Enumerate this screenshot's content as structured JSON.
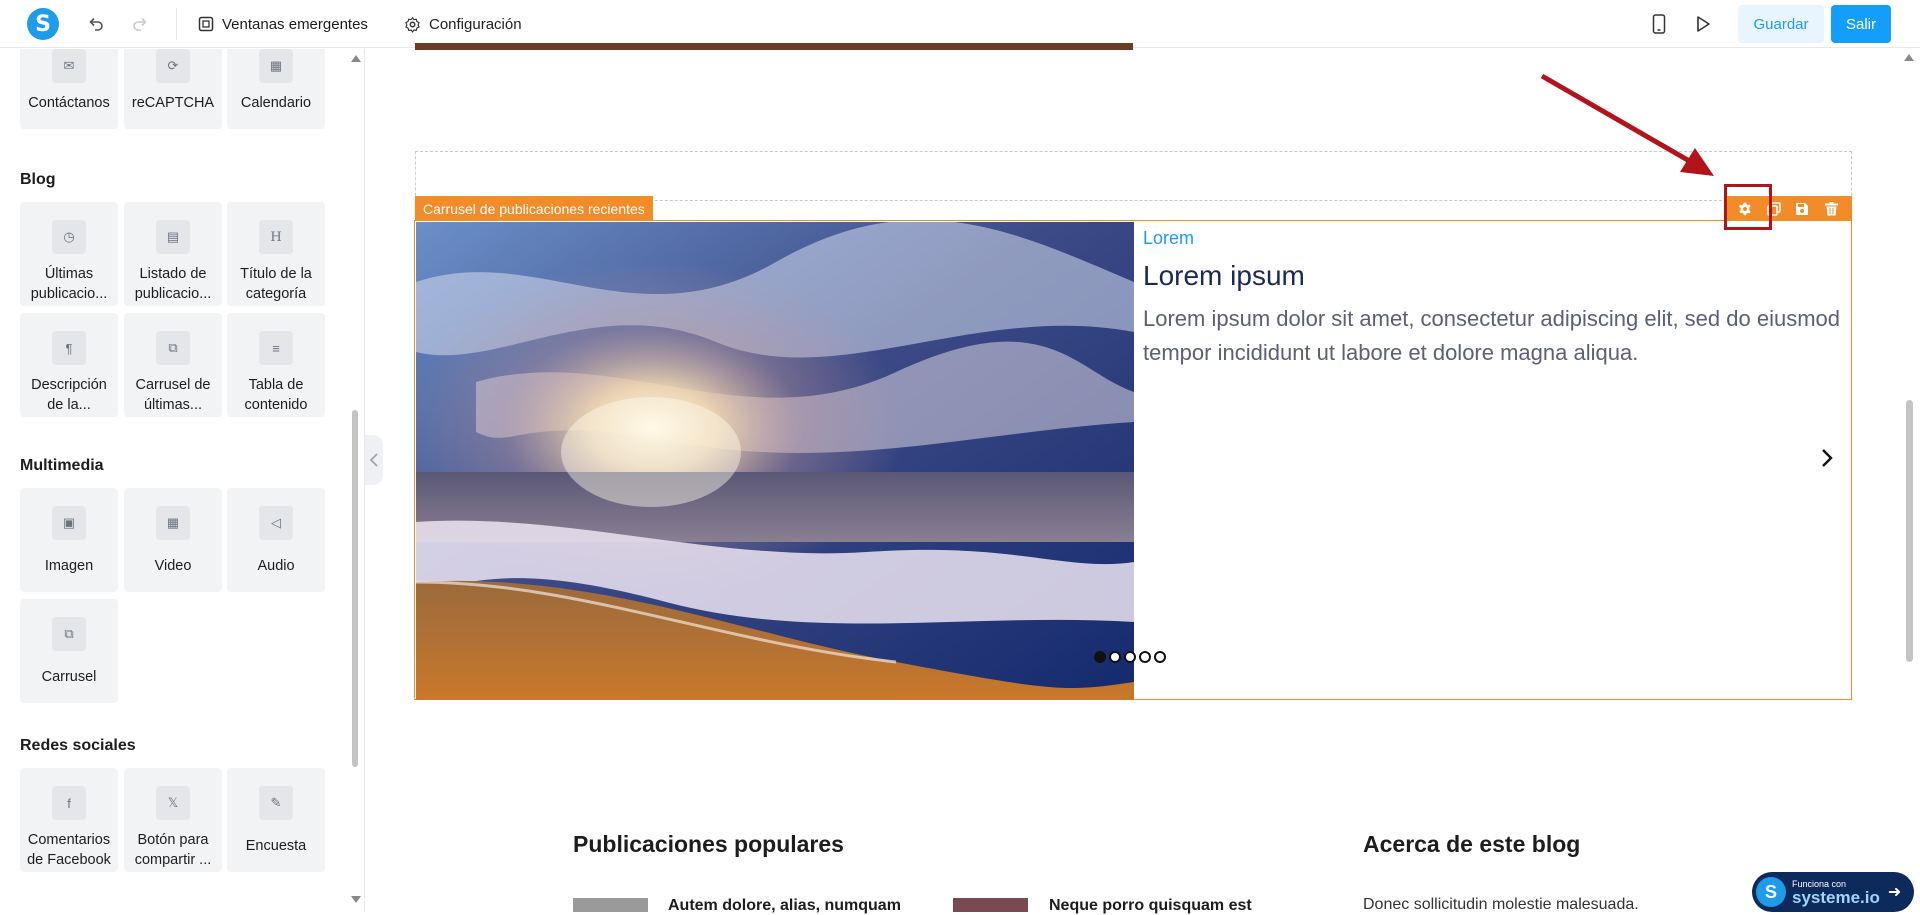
{
  "topbar": {
    "popups_label": "Ventanas emergentes",
    "settings_label": "Configuración",
    "save_label": "Guardar",
    "exit_label": "Salir"
  },
  "sidebar": {
    "top_tiles": [
      "Contáctanos",
      "reCAPTCHA",
      "Calendario"
    ],
    "sections": [
      {
        "title": "Blog",
        "tiles": [
          "Últimas publicacio...",
          "Listado de publicacio...",
          "Título de la categoría",
          "Descripción de la...",
          "Carrusel de últimas...",
          "Tabla de contenido"
        ]
      },
      {
        "title": "Multimedia",
        "tiles": [
          "Imagen",
          "Video",
          "Audio",
          "Carrusel"
        ]
      },
      {
        "title": "Redes sociales",
        "tiles": [
          "Comentarios de Facebook",
          "Botón para compartir ...",
          "Encuesta"
        ]
      }
    ]
  },
  "canvas": {
    "block_label": "Carrusel de publicaciones recientes",
    "post": {
      "category": "Lorem",
      "title": "Lorem ipsum",
      "description": "Lorem ipsum dolor sit amet, consectetur adipiscing elit, sed do eiusmod tempor incididunt ut labore et dolore magna aliqua."
    },
    "carousel_dots": 5,
    "active_dot": 0,
    "popular_heading": "Publicaciones populares",
    "about_heading": "Acerca de este blog",
    "popular_posts": [
      "Autem dolore, alias, numquam",
      "Neque porro quisquam est"
    ],
    "about_text": "Donec sollicitudin molestie malesuada."
  },
  "badge": {
    "small": "Funciona con",
    "main": "systeme.io"
  },
  "colors": {
    "accent": "#149efc",
    "block_orange": "#f28c28",
    "annotation_red": "#b3141b"
  }
}
